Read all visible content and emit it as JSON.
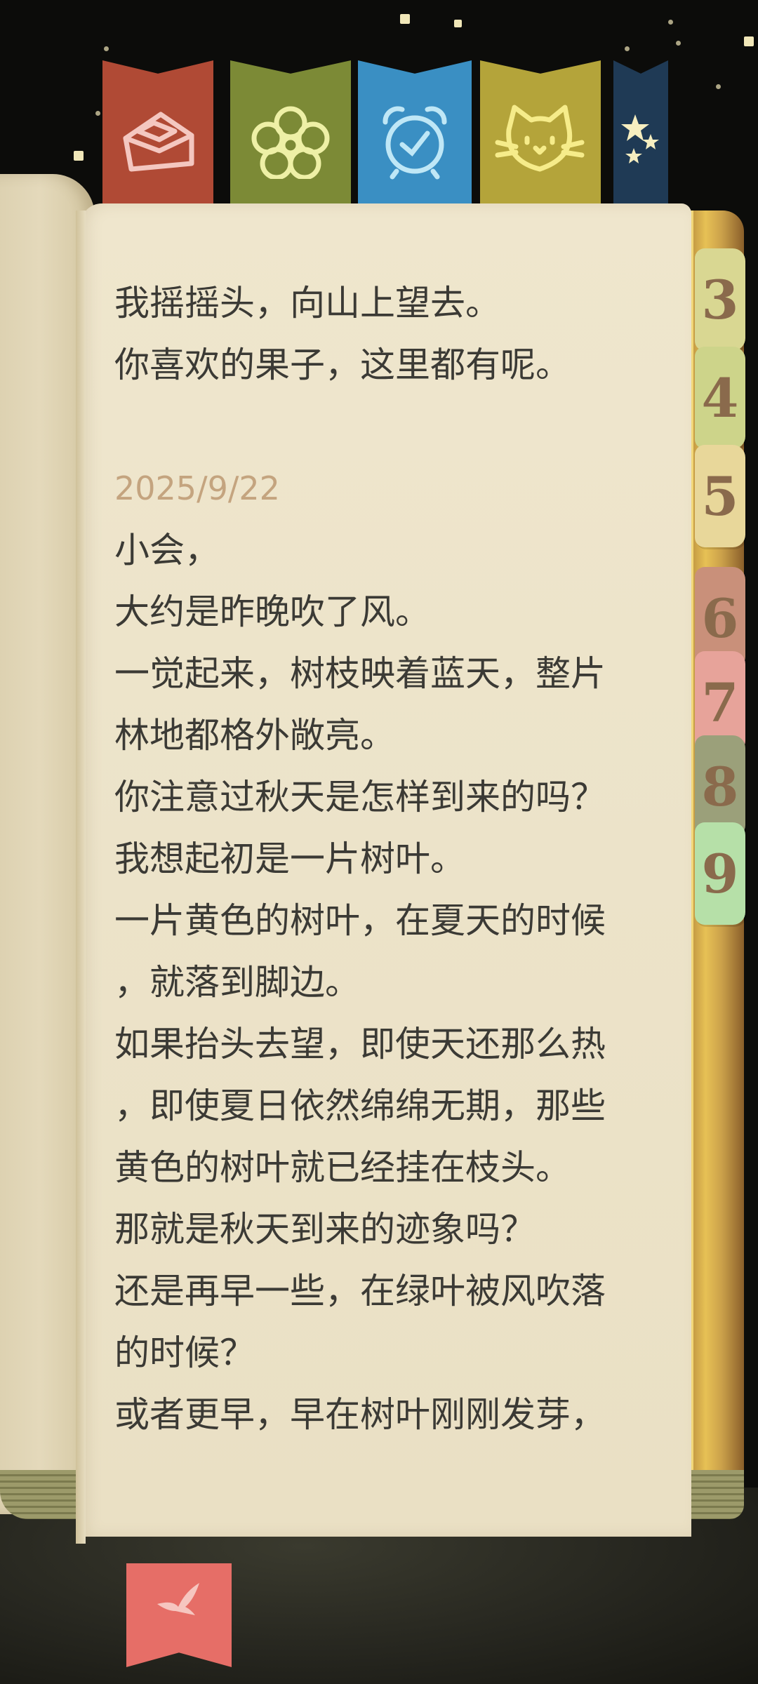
{
  "colors": {
    "page": "#ece3c9",
    "text": "#3b3a35",
    "date_text": "#c4a47f",
    "sky": "#0c0c0a"
  },
  "bookmarks_top": [
    {
      "icon": "envelope-icon",
      "color": "#b04a35"
    },
    {
      "icon": "flower-icon",
      "color": "#7c8a36"
    },
    {
      "icon": "alarm-clock-icon",
      "color": "#3a8fc3"
    },
    {
      "icon": "cat-face-icon",
      "color": "#b4a43a"
    },
    {
      "icon": "stars-icon",
      "color": "#1f3a55"
    }
  ],
  "chapter_tabs": [
    {
      "label": "3",
      "color": "#d9d792"
    },
    {
      "label": "4",
      "color": "#cdd48a"
    },
    {
      "label": "5",
      "color": "#e8d79a"
    },
    {
      "label": "6",
      "color": "#c9907a"
    },
    {
      "label": "7",
      "color": "#e7a39a"
    },
    {
      "label": "8",
      "color": "#9ba07a"
    },
    {
      "label": "9",
      "color": "#b6e0a8"
    }
  ],
  "ribbon_bookmark": {
    "icon": "bird-icon",
    "color": "#e66e67"
  },
  "diary": {
    "previous_lines": [
      "我摇摇头，向山上望去。",
      "你喜欢的果子，这里都有呢。"
    ],
    "date": "2025/9/22",
    "entry_lines": [
      "小会，",
      "大约是昨晚吹了风。",
      "一觉起来，树枝映着蓝天，整片",
      "林地都格外敞亮。",
      "你注意过秋天是怎样到来的吗？",
      "我想起初是一片树叶。",
      "一片黄色的树叶，在夏天的时候",
      "，就落到脚边。",
      "如果抬头去望，即使天还那么热",
      "，即使夏日依然绵绵无期，那些",
      "黄色的树叶就已经挂在枝头。",
      "那就是秋天到来的迹象吗？",
      "还是再早一些，在绿叶被风吹落",
      "的时候？",
      "或者更早，早在树叶刚刚发芽，"
    ]
  }
}
